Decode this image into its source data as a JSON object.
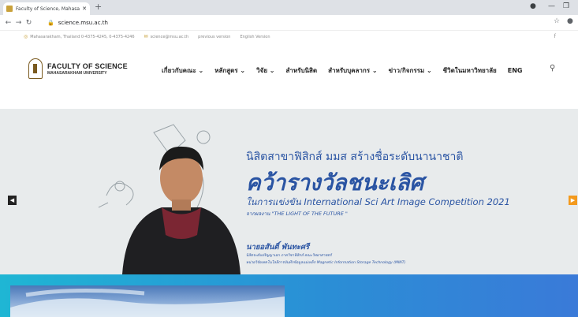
{
  "browser": {
    "tab_title": "Faculty of Science, Mahasarakha",
    "url": "science.msu.ac.th"
  },
  "infobar": {
    "address": "Mahasarakham, Thailand 0-4375-4245, 0-4375-4246",
    "email": "science@msu.ac.th",
    "previous": "previous version",
    "english": "English Version"
  },
  "logo": {
    "line1": "FACULTY OF SCIENCE",
    "line2": "MAHASARAKHAM UNIVERSITY"
  },
  "menu": [
    "เกี่ยวกับคณะ ⌄",
    "หลักสูตร ⌄",
    "วิจัย ⌄",
    "สำหรับนิสิต",
    "สำหรับบุคลากร ⌄",
    "ข่าว/กิจกรรม ⌄",
    "ชีวิตในมหาวิทยาลัย",
    "ENG"
  ],
  "hero": {
    "line1": "นิสิตสาขาฟิสิกส์ มมส สร้างชื่อระดับนานาชาติ",
    "line2": "คว้ารางวัลชนะเลิศ",
    "line3": "ในการแข่งขัน International Sci Art Image Competition 2021",
    "line4": "จากผลงาน \"THE LIGHT OF THE FUTURE \"",
    "name": "นายอสันติ์ พันทะศรี",
    "aff1": "นิสิตระดับปริญญาเอก ภาควิชาฟิสิกส์ คณะวิทยาศาสตร์",
    "aff2": "หน่วยวิจัยเทคโนโลยีการบันทึกข้อมูลแม่เหล็ก Magnetic Information Storage Technology (MINT)"
  },
  "colors": {
    "accent_orange": "#f39a1e",
    "hero_text": "#2a54a3",
    "band_start": "#1fb6d4",
    "band_end": "#3a7ad8"
  }
}
